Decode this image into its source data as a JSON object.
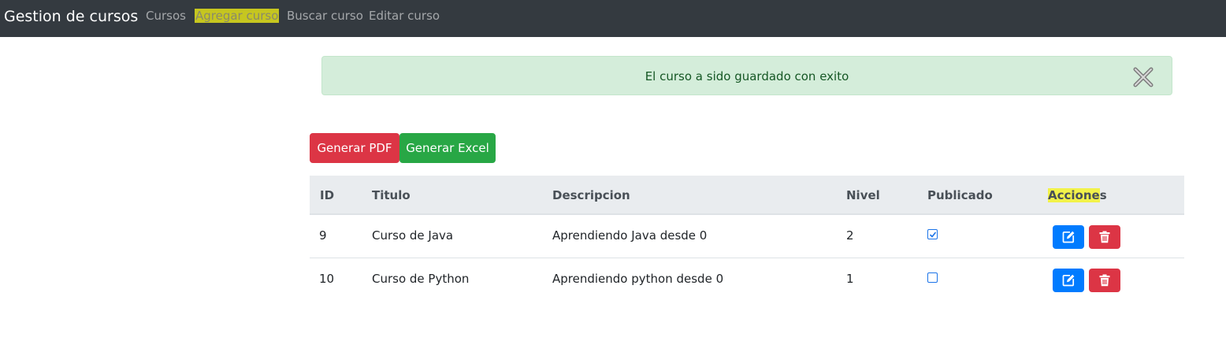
{
  "navbar": {
    "brand": "Gestion de cursos",
    "links": [
      "Cursos",
      "Agregar curso",
      "Buscar curso",
      "Editar curso"
    ]
  },
  "alert": {
    "message": "El curso a sido guardado con exito"
  },
  "buttons": {
    "pdf_label": "Generar PDF",
    "excel_label": "Generar Excel"
  },
  "table": {
    "headers": [
      "ID",
      "Titulo",
      "Descripcion",
      "Nivel",
      "Publicado"
    ],
    "acciones_highlighted": "Accione",
    "acciones_rest": "s",
    "rows": [
      {
        "id": "9",
        "titulo": "Curso de Java",
        "descripcion": "Aprendiendo Java desde 0",
        "nivel": "2",
        "publicado": true
      },
      {
        "id": "10",
        "titulo": "Curso de Python",
        "descripcion": "Aprendiendo python desde 0",
        "nivel": "1",
        "publicado": false
      }
    ]
  },
  "icons": {
    "alert_close": "close-icon",
    "edit": "edit-icon",
    "delete": "trash-icon",
    "checkbox_checked": "checkbox-checked-icon",
    "checkbox_unchecked": "checkbox-unchecked-icon"
  },
  "colors": {
    "navbar_bg": "#343a40",
    "alert_bg": "#d4edda",
    "alert_text": "#155724",
    "danger": "#dc3545",
    "success": "#28a745",
    "primary": "#007bff",
    "nav_highlight": "#c6c61f",
    "header_highlight": "#f2f24a"
  }
}
